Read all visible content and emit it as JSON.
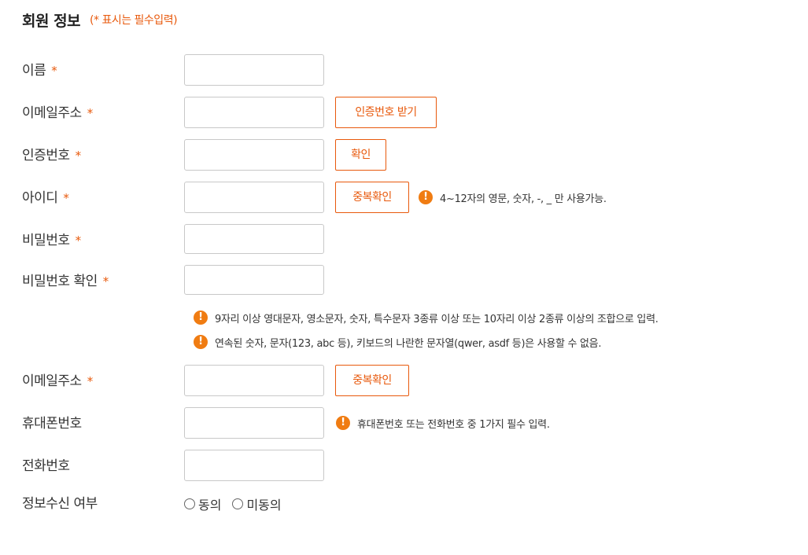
{
  "header": {
    "title": "회원 정보",
    "note": "(* 표시는 필수입력)"
  },
  "required_mark": "*",
  "fields": {
    "name": {
      "label": "이름"
    },
    "email_verify": {
      "label": "이메일주소",
      "button": "인증번호 받기"
    },
    "auth_code": {
      "label": "인증번호",
      "button": "확인"
    },
    "user_id": {
      "label": "아이디",
      "button": "중복확인",
      "hint": "4~12자의 영문, 숫자, -, _ 만 사용가능."
    },
    "password": {
      "label": "비밀번호"
    },
    "password_confirm": {
      "label": "비밀번호 확인"
    },
    "email": {
      "label": "이메일주소",
      "button": "중복확인"
    },
    "mobile": {
      "label": "휴대폰번호",
      "hint": "휴대폰번호 또는 전화번호 중 1가지 필수 입력."
    },
    "phone": {
      "label": "전화번호"
    },
    "subscription": {
      "label": "정보수신 여부",
      "options": [
        "동의",
        "미동의"
      ]
    }
  },
  "password_hints": [
    "9자리 이상 영대문자, 영소문자, 숫자, 특수문자 3종류 이상 또는 10자리 이상 2종류 이상의 조합으로 입력.",
    "연속된 숫자, 문자(123, abc 등), 키보드의 나란한 문자열(qwer, asdf 등)은 사용할 수 없음."
  ],
  "icons": {
    "warning": "exclamation-circle-icon"
  },
  "colors": {
    "accent": "#e8590c",
    "warning_icon": "#f07c12",
    "input_border": "#c8c8c8"
  }
}
